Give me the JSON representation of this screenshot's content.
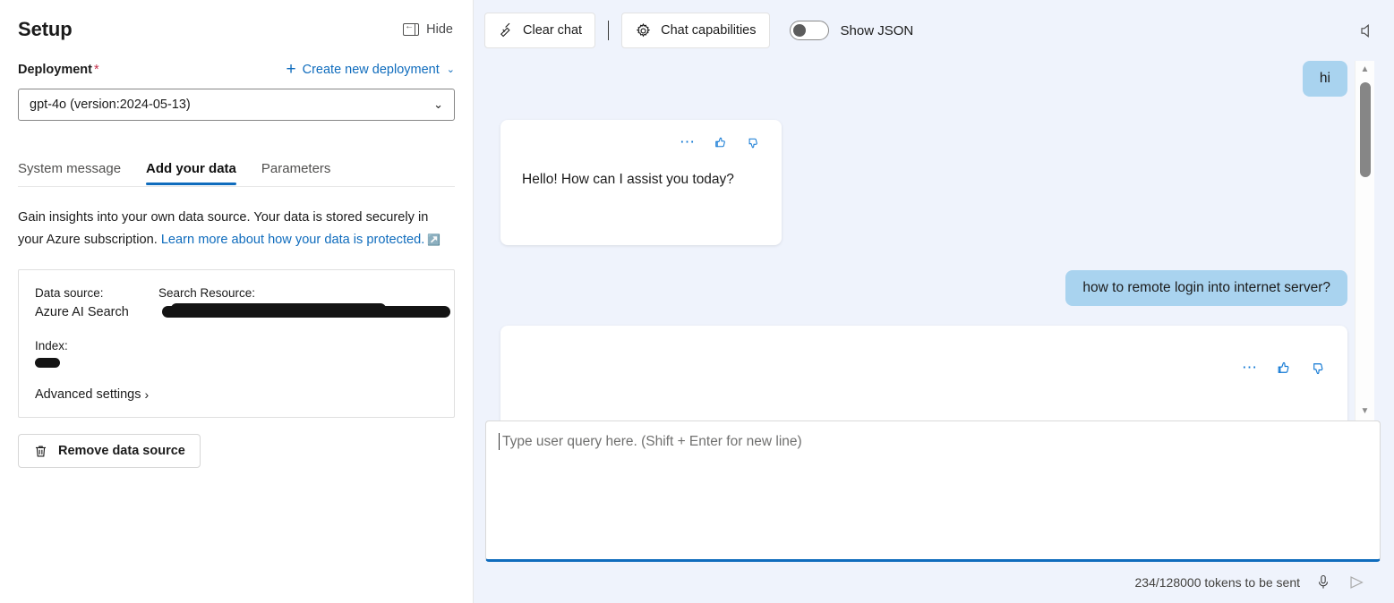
{
  "setup": {
    "title": "Setup",
    "hide_label": "Hide",
    "hide_icon": "panel-collapse-icon",
    "deployment_label": "Deployment",
    "required_marker": "*",
    "create_deployment_label": "Create new deployment",
    "deployment_value": "gpt-4o (version:2024-05-13)",
    "tabs": [
      {
        "label": "System message",
        "active": false
      },
      {
        "label": "Add your data",
        "active": true
      },
      {
        "label": "Parameters",
        "active": false
      }
    ],
    "description_text_1": "Gain insights into your own data source. Your data is stored securely in your Azure subscription. ",
    "description_link": "Learn more about how your data is protected.",
    "data_source": {
      "data_source_key": "Data source:",
      "data_source_value": "Azure AI Search",
      "search_resource_key": "Search Resource:",
      "search_resource_value": "",
      "index_key": "Index:",
      "index_value": "",
      "advanced_settings_label": "Advanced settings"
    },
    "remove_button_label": "Remove data source"
  },
  "chat": {
    "toolbar": {
      "clear_chat_label": "Clear chat",
      "clear_chat_icon": "broom-icon",
      "chat_capabilities_label": "Chat capabilities",
      "chat_capabilities_icon": "gear-icon",
      "show_json_label": "Show JSON",
      "show_json_enabled": false,
      "speaker_icon": "speaker-mute-icon"
    },
    "messages": [
      {
        "role": "user",
        "text": "hi"
      },
      {
        "role": "assistant",
        "text": "Hello! How can I assist you today?"
      },
      {
        "role": "user",
        "text": "how to remote login into internet server?"
      },
      {
        "role": "assistant",
        "text": ""
      }
    ],
    "message_actions": {
      "more_icon": "ellipsis-icon",
      "thumbs_up_icon": "thumbs-up-icon",
      "thumbs_down_icon": "thumbs-down-icon"
    },
    "composer": {
      "placeholder": "Type user query here. (Shift + Enter for new line)",
      "value": "",
      "token_status": "234/128000 tokens to be sent",
      "mic_icon": "microphone-icon",
      "send_icon": "send-arrow-icon"
    }
  },
  "colors": {
    "accent_blue": "#0f6cbd",
    "user_bubble": "#a9d3ef",
    "chat_background": "#eff3fc",
    "required_red": "#c4314b"
  }
}
